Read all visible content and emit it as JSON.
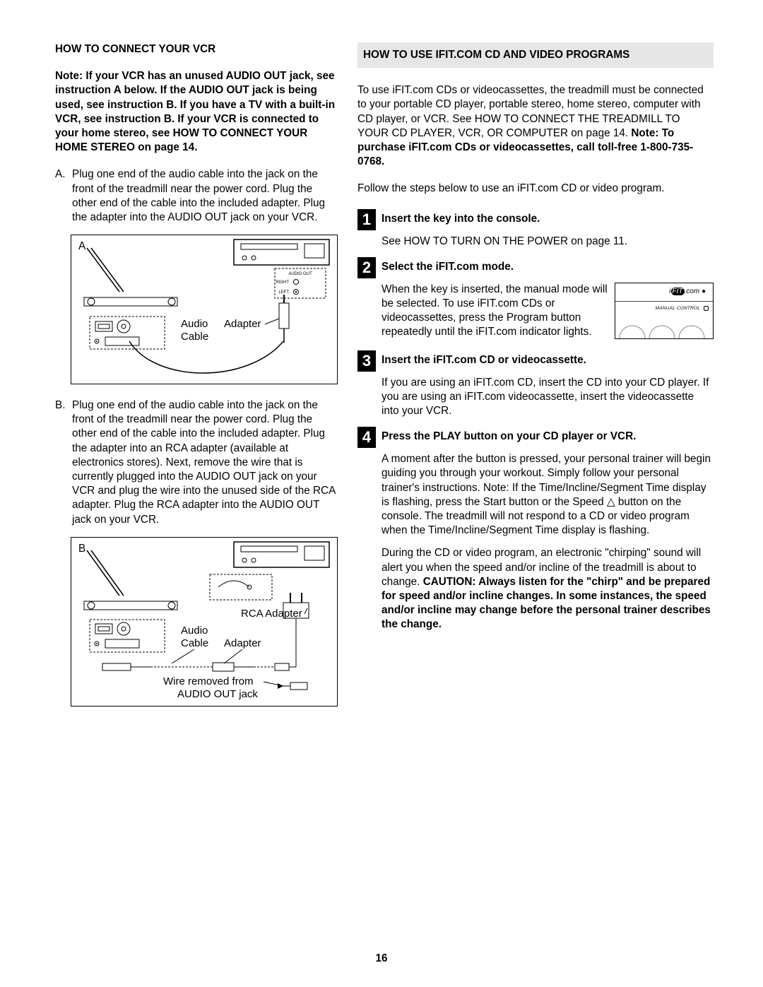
{
  "page_number": "16",
  "left": {
    "heading": "HOW TO CONNECT YOUR VCR",
    "note": "Note: If your VCR has an unused AUDIO OUT jack, see instruction A below. If the AUDIO OUT jack is being used, see instruction B. If you have a TV with a built-in VCR, see instruction B. If your VCR is connected to your home stereo, see HOW TO CONNECT YOUR HOME STEREO on page 14.",
    "item_a_letter": "A.",
    "item_a": "Plug one end of the audio cable into the jack on the front of the treadmill near the power cord. Plug the other end of the cable into the included adapter. Plug the adapter into the AUDIO OUT jack on your VCR.",
    "item_b_letter": "B.",
    "item_b": "Plug one end of the audio cable into the jack on the front of the treadmill near the power cord. Plug the other end of the cable into the included adapter. Plug the adapter into an RCA adapter (available at electronics stores). Next, remove the wire that is currently plugged into the AUDIO OUT jack on your VCR and plug the wire into the unused side of the RCA adapter. Plug the RCA adapter into the AUDIO OUT jack on your VCR.",
    "diagram_a": {
      "letter": "A",
      "labels": {
        "audio_cable": "Audio\nCable",
        "adapter": "Adapter",
        "audio_out": "AUDIO OUT",
        "right": "RIGHT",
        "left": "LEFT"
      }
    },
    "diagram_b": {
      "letter": "B",
      "labels": {
        "audio_cable": "Audio\nCable",
        "adapter": "Adapter",
        "rca_adapter": "RCA Adapter",
        "wire_removed": "Wire removed from\nAUDIO OUT jack"
      }
    }
  },
  "right": {
    "heading": "HOW TO USE IFIT.COM CD AND VIDEO PROGRAMS",
    "intro_part1": "To use iFIT.com CDs or videocassettes, the treadmill must be connected to your portable CD player, portable stereo, home stereo, computer with CD player, or VCR. See HOW TO CONNECT THE TREADMILL TO YOUR CD PLAYER, VCR, OR COMPUTER on page 14. ",
    "intro_part2_bold": "Note: To purchase iFIT.com CDs or videocassettes, call toll-free 1-800-735-0768.",
    "follow": "Follow the steps below to use an iFIT.com CD or video program.",
    "console_fig": {
      "logo_text": "iFIT.com",
      "manual_control": "MANUAL CONTROL"
    },
    "steps": [
      {
        "num": "1",
        "title": "Insert the key into the console.",
        "body": "See HOW TO TURN ON THE POWER on page 11."
      },
      {
        "num": "2",
        "title": "Select the iFIT.com mode.",
        "body": "When the key is inserted, the manual mode will be selected. To use iFIT.com CDs or videocassettes, press the Program button repeatedly until the iFIT.com indicator lights."
      },
      {
        "num": "3",
        "title": "Insert the iFIT.com CD or videocassette.",
        "body": "If you are using an iFIT.com CD, insert the CD into your CD player. If you are using an iFIT.com videocassette, insert the videocassette into your VCR."
      },
      {
        "num": "4",
        "title": "Press the PLAY button on your CD player or VCR.",
        "body": "A moment after the button is pressed, your personal trainer will begin guiding you through your workout. Simply follow your personal trainer's instructions. Note: If the Time/Incline/Segment Time display is flashing, press the Start button or the Speed △ button on the console. The treadmill will not respond to a CD or video program when the Time/Incline/Segment Time display is flashing.",
        "body2_plain": "During the CD or video program, an electronic \"chirping\" sound will alert you when the speed and/or incline of the treadmill is about to change. ",
        "body2_bold": "CAUTION: Always listen for the \"chirp\" and be prepared for speed and/or incline changes. In some instances, the speed and/or incline may change before the personal trainer describes the change."
      }
    ]
  }
}
